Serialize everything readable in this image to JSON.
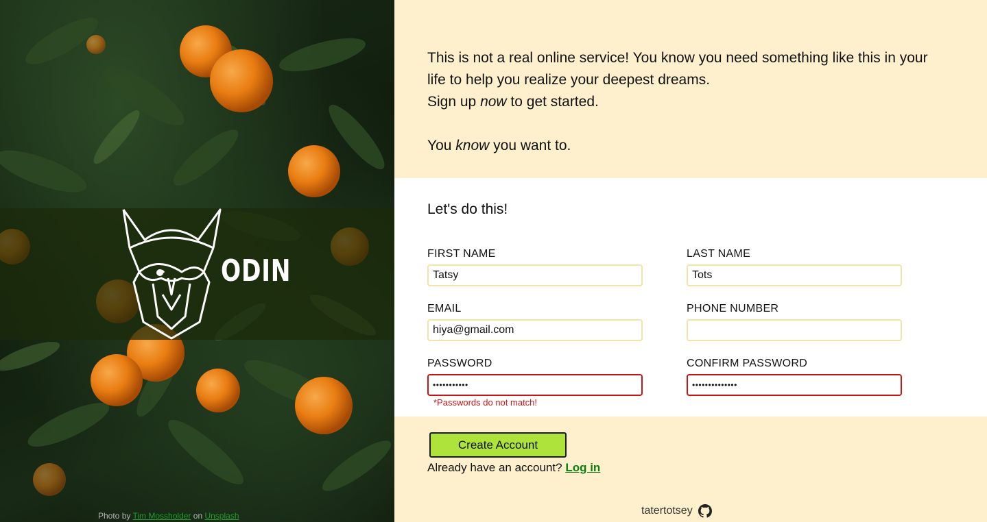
{
  "hero": {
    "logo_word": "ODIN",
    "credit": {
      "prefix": "Photo by",
      "author": "Tim Mossholder",
      "middle": "on",
      "site": "Unsplash"
    }
  },
  "intro": {
    "line1": "This is not a real online service! You know you need something like this in your life to help you realize your deepest dreams.",
    "line2_pre": "Sign up ",
    "line2_em": "now",
    "line2_post": " to get started.",
    "line3_pre": "You ",
    "line3_em": "know",
    "line3_post": " you want to."
  },
  "form": {
    "title": "Let's do this!",
    "first_name": {
      "label": "FIRST NAME",
      "value": "Tatsy"
    },
    "last_name": {
      "label": "LAST NAME",
      "value": "Tots"
    },
    "email": {
      "label": "EMAIL",
      "value": "hiya@gmail.com"
    },
    "phone": {
      "label": "PHONE NUMBER",
      "value": ""
    },
    "password": {
      "label": "PASSWORD",
      "value": "•••••••••••"
    },
    "confirm_password": {
      "label": "CONFIRM PASSWORD",
      "value": "••••••••••••••"
    },
    "error": "*Passwords do not match!"
  },
  "actions": {
    "create_label": "Create Account",
    "login_prompt": "Already have an account?",
    "login_link": "Log in"
  },
  "footer": {
    "username": "tatertotsey",
    "icon": "github-icon"
  },
  "colors": {
    "panel_bg": "#fef0cc",
    "button_bg": "#aee33c",
    "error": "#c81414",
    "link": "#0c7f10"
  }
}
